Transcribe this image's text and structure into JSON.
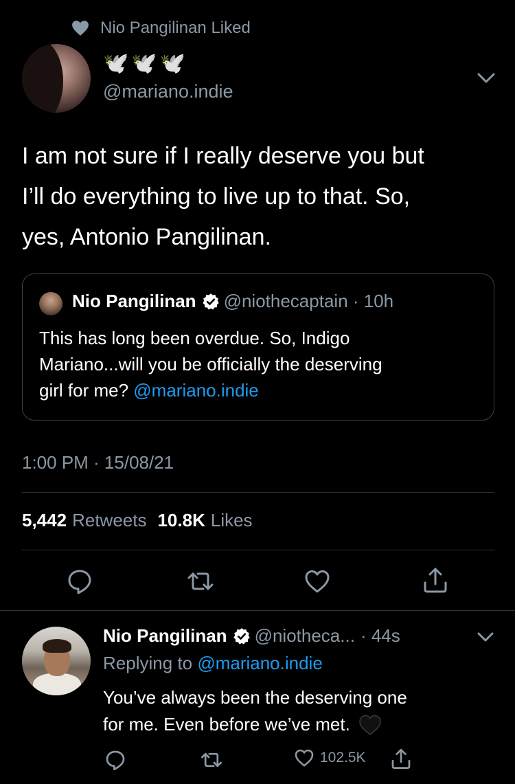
{
  "liked_by": {
    "text": "Nio Pangilinan Liked",
    "icon": "heart-icon"
  },
  "tweet": {
    "display_name_emojis": [
      "🕊️",
      "🕊️",
      "🕊️"
    ],
    "handle": "@mariano.indie",
    "text_lines": [
      "I am not sure if I really deserve you but",
      "I’ll do everything to live up to that. So,",
      "yes, Antonio Pangilinan."
    ],
    "quote": {
      "name": "Nio Pangilinan",
      "handle_time": "@niothecaptain · 10h",
      "text_lines": [
        "This has long been overdue. So, Indigo",
        "Mariano...will you be officially the deserving",
        "girl for me?"
      ],
      "mention": "@mariano.indie"
    },
    "timestamp": "1:00 PM · 15/08/21",
    "retweets_count": "5,442",
    "retweets_label": "Retweets",
    "likes_count": "10.8K",
    "likes_label": "Likes"
  },
  "reply": {
    "name": "Nio Pangilinan",
    "handle": "@niotheca...",
    "time": "· 44s",
    "replying_prefix": "Replying to",
    "replying_to": "@mariano.indie",
    "text_lines": [
      "You’ve always been the deserving one",
      "for me. Even before we’ve met."
    ],
    "like_count": "102.5K"
  },
  "colors": {
    "background": "#000000",
    "secondary_text": "#8b98a5",
    "link": "#1d9bf0",
    "divider": "#2f3336"
  }
}
